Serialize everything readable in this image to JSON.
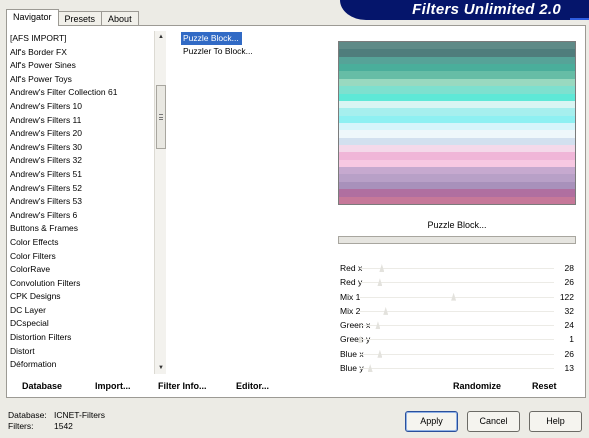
{
  "banner": {
    "title": "Filters Unlimited 2.0"
  },
  "tabs": [
    {
      "label": "Navigator",
      "active": true
    },
    {
      "label": "Presets",
      "active": false
    },
    {
      "label": "About",
      "active": false
    }
  ],
  "categories": [
    "[AFS IMPORT]",
    "Alf's Border FX",
    "Alf's Power Sines",
    "Alf's Power Toys",
    "Andrew's Filter Collection 61",
    "Andrew's Filters 10",
    "Andrew's Filters 11",
    "Andrew's Filters 20",
    "Andrew's Filters 30",
    "Andrew's Filters 32",
    "Andrew's Filters 51",
    "Andrew's Filters 52",
    "Andrew's Filters 53",
    "Andrew's Filters 6",
    "Buttons & Frames",
    "Color Effects",
    "Color Filters",
    "ColorRave",
    "Convolution Filters",
    "CPK Designs",
    "DC Layer",
    "DCspecial",
    "Distortion Filters",
    "Distort",
    "Déformation"
  ],
  "filters": [
    "Puzzle Block...",
    "Puzzler To Block..."
  ],
  "selected_filter": "Puzzle Block...",
  "preview_colors": [
    "#5f8a87",
    "#4f7d7c",
    "#56a398",
    "#4aae9b",
    "#66bda6",
    "#99d9c0",
    "#7ee0cf",
    "#5ee8d7",
    "#d9f5f3",
    "#a6efee",
    "#8ef0f2",
    "#d6f5fb",
    "#eef7fb",
    "#d2e0ef",
    "#f4d9ea",
    "#f0b6d8",
    "#f7c8e2",
    "#c6a9cf",
    "#b8a0c7",
    "#a891bb",
    "#b06fa0",
    "#c67899"
  ],
  "filter_name_display": "Puzzle Block...",
  "sliders": [
    {
      "label": "Red x",
      "value": 28,
      "fraction": 0.11
    },
    {
      "label": "Red y",
      "value": 26,
      "fraction": 0.1
    },
    {
      "label": "Mix 1",
      "value": 122,
      "fraction": 0.48
    },
    {
      "label": "Mix 2",
      "value": 32,
      "fraction": 0.13
    },
    {
      "label": "Green x",
      "value": 24,
      "fraction": 0.09
    },
    {
      "label": "Green y",
      "value": 1,
      "fraction": 0.0
    },
    {
      "label": "Blue x",
      "value": 26,
      "fraction": 0.1
    },
    {
      "label": "Blue y",
      "value": 13,
      "fraction": 0.05
    }
  ],
  "panel_buttons": {
    "database": "Database",
    "import": "Import...",
    "filter_info": "Filter Info...",
    "editor": "Editor...",
    "randomize": "Randomize",
    "reset": "Reset"
  },
  "footer": {
    "database_label": "Database:",
    "database_value": "ICNET-Filters",
    "filters_label": "Filters:",
    "filters_value": "1542"
  },
  "buttons": {
    "apply": "Apply",
    "cancel": "Cancel",
    "help": "Help"
  }
}
